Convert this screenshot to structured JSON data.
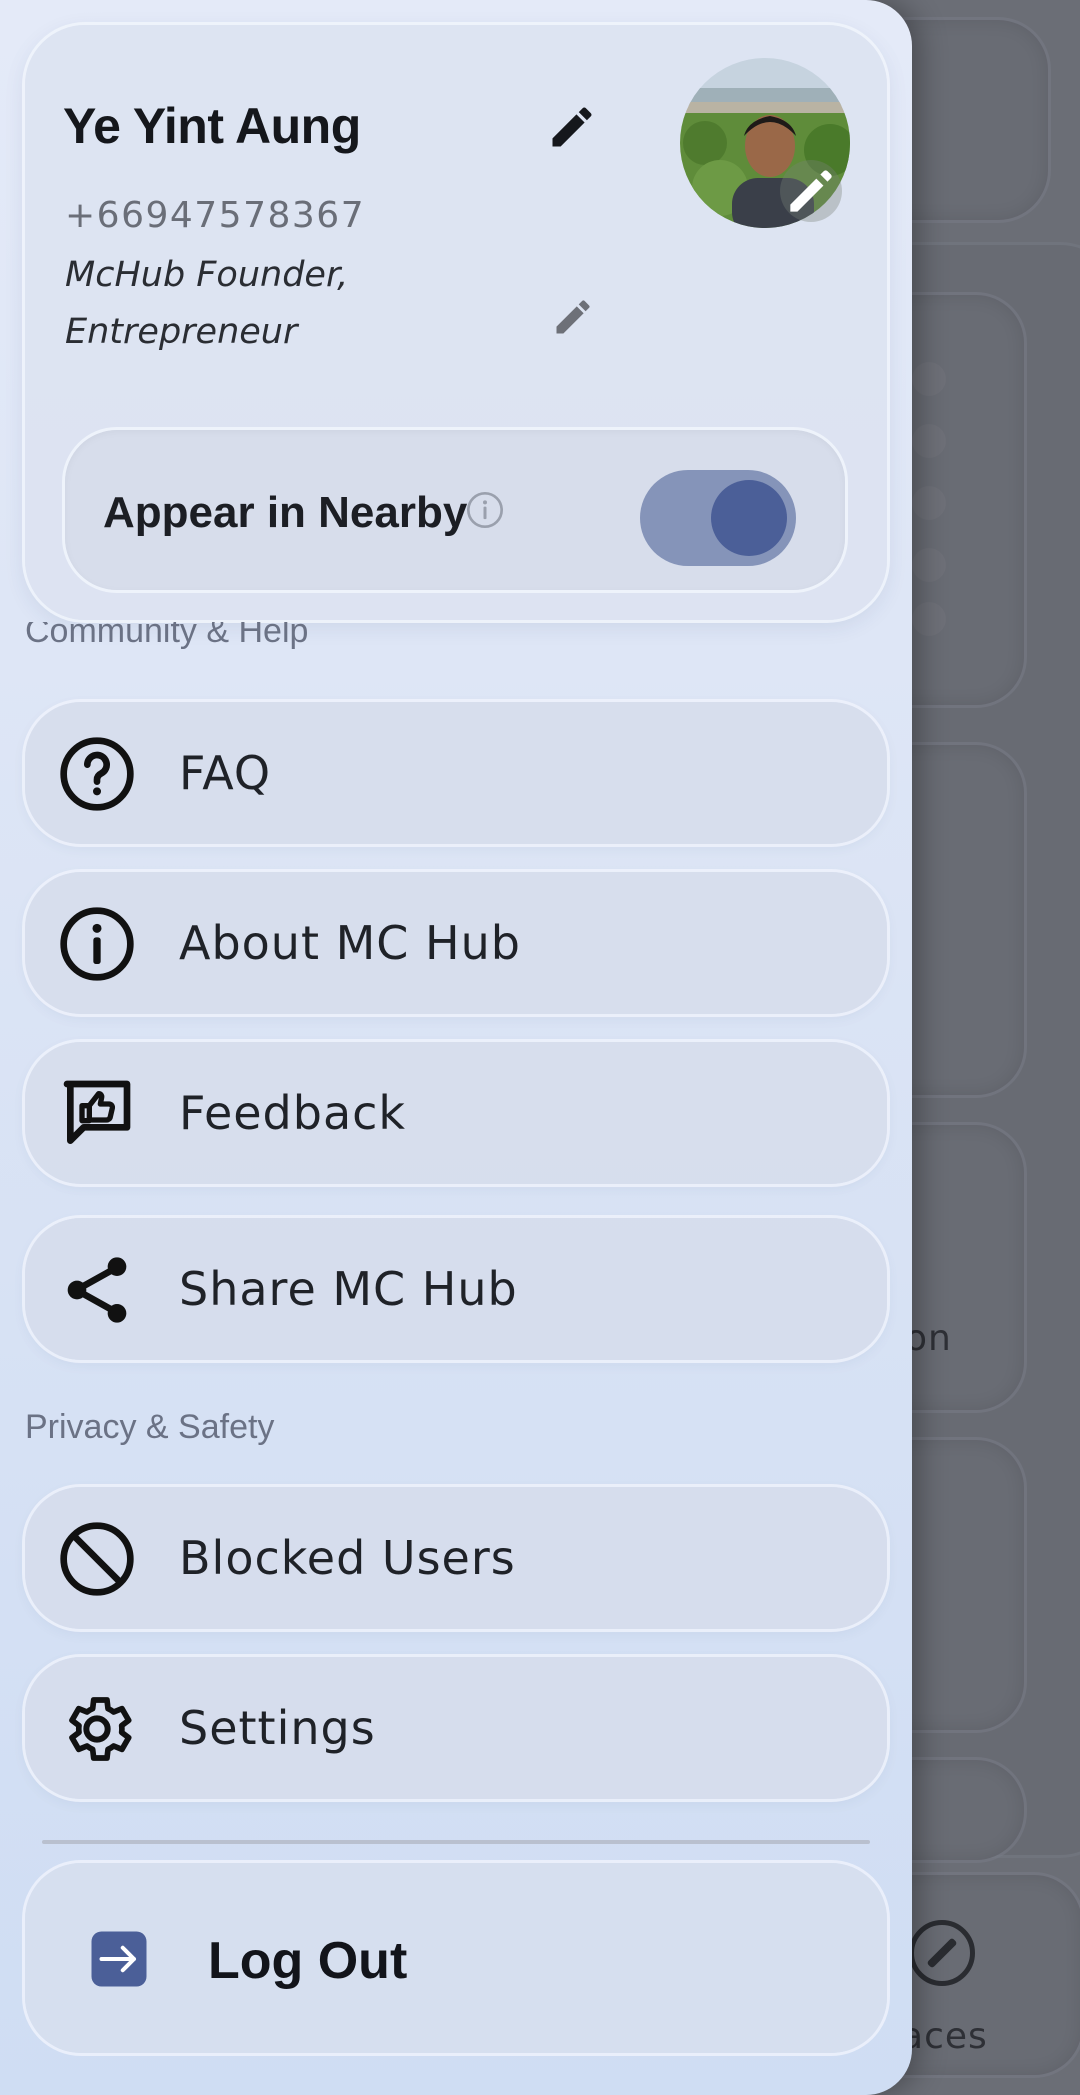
{
  "profile": {
    "name": "Ye Yint Aung",
    "phone": "+66947578367",
    "bio_line1": "McHub Founder,",
    "bio_line2": "Entrepreneur"
  },
  "nearby": {
    "label": "Appear in Nearby",
    "enabled": true
  },
  "sections": {
    "community": "Community & Help",
    "privacy": "Privacy & Safety"
  },
  "menu": {
    "faq": {
      "label": "FAQ",
      "icon": "question-circle-icon"
    },
    "about": {
      "label": "About MC Hub",
      "icon": "info-circle-icon"
    },
    "feedback": {
      "label": "Feedback",
      "icon": "thumbs-up-chat-icon"
    },
    "share": {
      "label": "Share MC Hub",
      "icon": "share-icon"
    },
    "blocked": {
      "label": "Blocked Users",
      "icon": "block-icon"
    },
    "settings": {
      "label": "Settings",
      "icon": "gear-icon"
    }
  },
  "logout": {
    "label": "Log Out",
    "icon": "logout-icon"
  },
  "background": {
    "partial_text_1": "on",
    "partial_text_2": "laces",
    "nav_icon": "compass-icon"
  },
  "colors": {
    "toggle_track": "#8594b9",
    "toggle_knob": "#4b5f98",
    "logout_icon": "#4b5f98"
  }
}
